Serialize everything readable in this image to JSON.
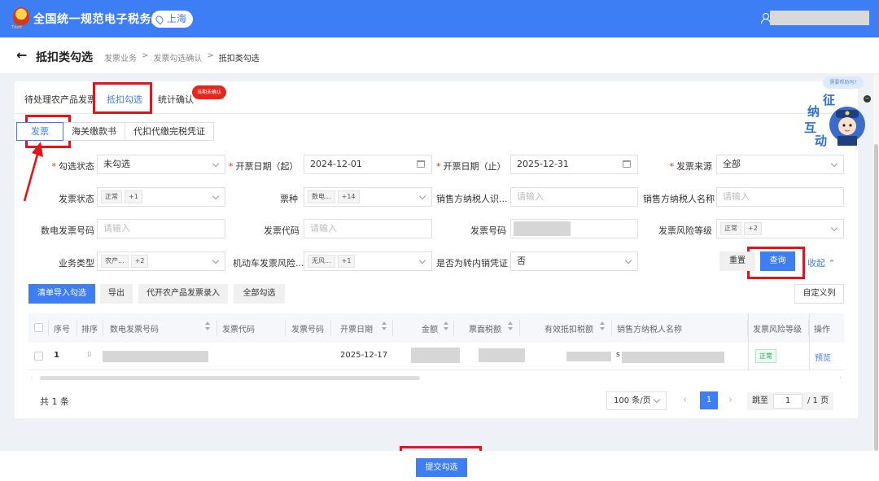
{
  "header": {
    "logo_text": "Tdxtt",
    "title": "全国统一规范电子税务局",
    "region": "上海"
  },
  "page": {
    "title": "抵扣类勾选",
    "breadcrumb": [
      "发票业务",
      ">",
      "发票勾选确认",
      ">",
      "抵扣类勾选"
    ]
  },
  "tabs": [
    {
      "label": "待处理农产品发票"
    },
    {
      "label": "抵扣勾选"
    },
    {
      "label": "统计确认"
    }
  ],
  "tab_badge": "当期未确认",
  "subtabs": [
    "发票",
    "海关缴款书",
    "代扣代缴完税凭证"
  ],
  "filters": {
    "check_status": {
      "label": "勾选状态",
      "value": "未勾选"
    },
    "date_start": {
      "label": "开票日期（起）",
      "value": "2024-12-01"
    },
    "date_end": {
      "label": "开票日期（止）",
      "value": "2025-12-31"
    },
    "source": {
      "label": "发票来源",
      "value": "全部"
    },
    "invoice_status": {
      "label": "发票状态",
      "tag": "正常",
      "more": "+1"
    },
    "invoice_type": {
      "label": "票种",
      "tag": "数电...",
      "more": "+14"
    },
    "seller_tax_id": {
      "label": "销售方纳税人识...",
      "placeholder": "请输入"
    },
    "seller_name": {
      "label": "销售方纳税人名称",
      "placeholder": "请输入"
    },
    "digital_no": {
      "label": "数电发票号码",
      "placeholder": "请输入"
    },
    "invoice_code": {
      "label": "发票代码",
      "placeholder": "请输入"
    },
    "invoice_no": {
      "label": "发票号码"
    },
    "risk_level": {
      "label": "发票风险等级",
      "tag": "正常",
      "more": "+2"
    },
    "biz_type": {
      "label": "业务类型",
      "tag": "农产...",
      "more": "+2"
    },
    "vehicle_risk": {
      "label": "机动车发票风险...",
      "tag": "无风...",
      "more": "+1"
    },
    "domestic_transfer": {
      "label": "是否为转内销凭证",
      "value": "否"
    }
  },
  "buttons": {
    "reset": "重置",
    "query": "查询",
    "collapse": "收起",
    "import": "清单导入勾选",
    "export": "导出",
    "agri_entry": "代开农产品发票录入",
    "select_all": "全部勾选",
    "custom_cols": "自定义列",
    "submit": "提交勾选"
  },
  "table": {
    "columns": [
      "序号",
      "排序",
      "数电发票号码",
      "发票代码",
      "发票号码",
      "开票日期",
      "金额",
      "票面税额",
      "有效抵扣税额",
      "销售方纳税人名称",
      "发票风险等级",
      "操作"
    ],
    "rows": [
      {
        "seq": "1",
        "handle": "⁞⁞",
        "date": "2025-12-17",
        "risk": "正常",
        "action": "预览",
        "name_prefix": "s"
      }
    ]
  },
  "pagination": {
    "total": "共 1 条",
    "page_size": "100 条/页",
    "current": "1",
    "jump_label": "跳至",
    "jump_value": "1",
    "page_total": "/ 1 页"
  },
  "help": {
    "bubble": "需要帮助吗?",
    "chars": [
      "征",
      "纳",
      "互",
      "动"
    ]
  },
  "colors": {
    "primary": "#3d7ef5",
    "highlight": "#e4141a",
    "badge": "#e8261e"
  }
}
